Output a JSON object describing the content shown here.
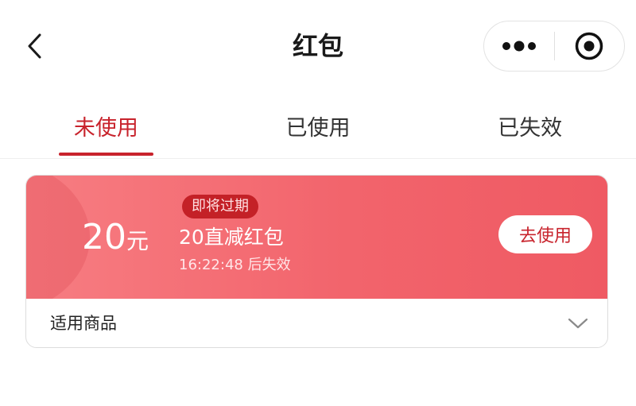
{
  "header": {
    "title": "红包",
    "back_icon": "chevron-left-icon",
    "more_icon": "more-dots-icon",
    "close_icon": "target-circle-icon"
  },
  "tabs": [
    {
      "label": "未使用",
      "active": true
    },
    {
      "label": "已使用",
      "active": false
    },
    {
      "label": "已失效",
      "active": false
    }
  ],
  "coupon": {
    "amount": "20",
    "unit": "元",
    "badge": "即将过期",
    "name": "20直减红包",
    "countdown": "16:22:48",
    "expire_suffix": "后失效",
    "use_label": "去使用",
    "goods_label": "适用商品",
    "expand_icon": "chevron-down-icon"
  },
  "colors": {
    "accent": "#c8232c",
    "coupon_red": "#f2646c",
    "badge_red": "#c42127"
  }
}
